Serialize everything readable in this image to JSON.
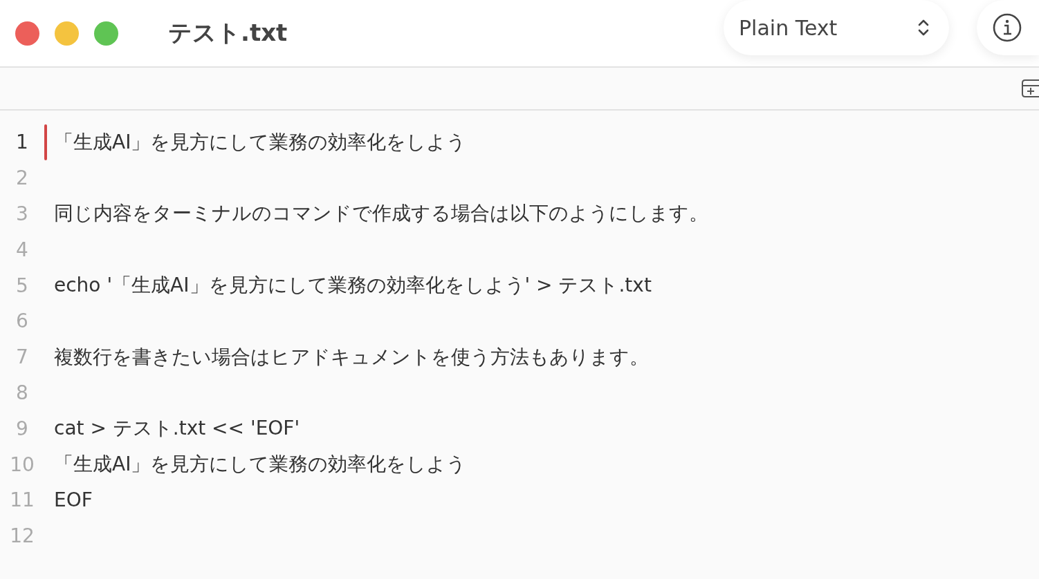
{
  "window": {
    "title": "テスト.txt"
  },
  "syntax_menu": {
    "label": "Plain Text"
  },
  "lines": [
    {
      "number": "1",
      "text": "「生成AI」を見方にして業務の効率化をしよう",
      "selected": true
    },
    {
      "number": "2",
      "selected": false
    },
    {
      "number": "3",
      "text": "同じ内容をターミナルのコマンドで作成する場合は以下のようにします。",
      "selected": false
    },
    {
      "number": "4",
      "selected": false
    },
    {
      "number": "5",
      "text": "echo '「生成AI」を見方にして業務の効率化をしよう' > テスト.txt",
      "selected": false
    },
    {
      "number": "6",
      "selected": false
    },
    {
      "number": "7",
      "text": "複数行を書きたい場合はヒアドキュメントを使う方法もあります。",
      "selected": false
    },
    {
      "number": "8",
      "selected": false
    },
    {
      "number": "9",
      "text": "cat > テスト.txt << 'EOF'",
      "selected": false
    },
    {
      "number": "10",
      "text": "「生成AI」を見方にして業務の効率化をしよう",
      "selected": false
    },
    {
      "number": "11",
      "text": "EOF",
      "selected": false
    },
    {
      "number": "12",
      "selected": false
    }
  ]
}
